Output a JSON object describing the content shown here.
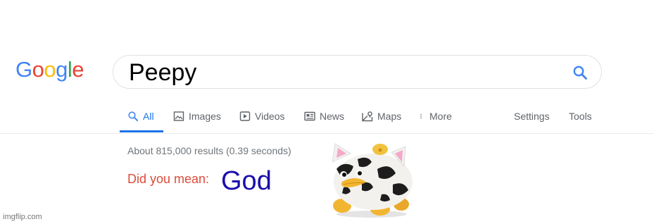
{
  "logo": {
    "letters": [
      "G",
      "o",
      "o",
      "g",
      "l",
      "e"
    ],
    "colors": [
      "#4285f4",
      "#ea4335",
      "#fbbc05",
      "#4285f4",
      "#34a853",
      "#ea4335"
    ]
  },
  "search": {
    "query": "Peepy",
    "icon": "search-icon",
    "icon_color": "#4285f4"
  },
  "tabs": [
    {
      "label": "All",
      "icon": "search-icon",
      "active": true
    },
    {
      "label": "Images",
      "icon": "image-icon",
      "active": false
    },
    {
      "label": "Videos",
      "icon": "video-icon",
      "active": false
    },
    {
      "label": "News",
      "icon": "news-icon",
      "active": false
    },
    {
      "label": "Maps",
      "icon": "map-icon",
      "active": false
    },
    {
      "label": "More",
      "icon": "more-vert-icon",
      "active": false
    }
  ],
  "tools": {
    "settings": "Settings",
    "tools": "Tools"
  },
  "results": {
    "stats": "About 815,000 results (0.39 seconds)",
    "did_you_mean_label": "Did you mean:",
    "suggestion": "God"
  },
  "image": {
    "name": "cow-patterned-toy-photo"
  },
  "watermark": "imgflip.com",
  "colors": {
    "active_tab": "#1a73e8",
    "did_you_mean": "#dd4b39",
    "suggestion_link": "#1a0dab",
    "muted_text": "#70757a"
  }
}
